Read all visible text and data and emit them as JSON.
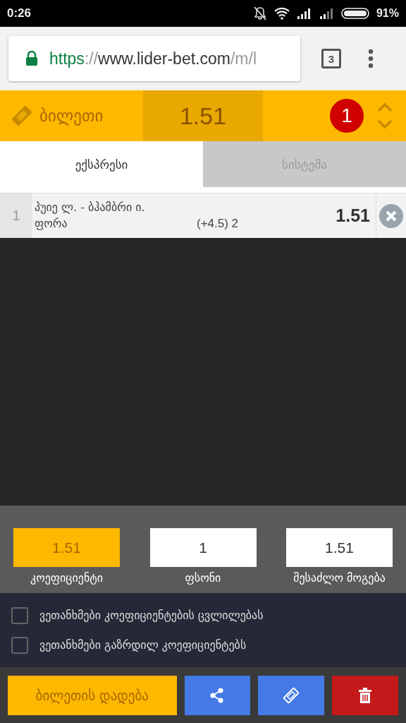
{
  "status_bar": {
    "time": "0:26",
    "battery": "91%"
  },
  "browser": {
    "url": [
      {
        "text": "https",
        "kind": "scheme"
      },
      {
        "text": "://",
        "kind": "faint"
      },
      {
        "text": "www.lider-bet.com",
        "kind": "host"
      },
      {
        "text": "/m/l",
        "kind": "faint"
      }
    ],
    "tab_count": "3"
  },
  "ticket_header": {
    "title": "ბილეთი",
    "odds": "1.51",
    "count": "1"
  },
  "tabs": [
    {
      "label": "ექსპრესი",
      "selected": true
    },
    {
      "label": "სისტემა",
      "selected": false
    }
  ],
  "bets": [
    {
      "number": "1",
      "event": "პუიე ლ. - ბჰამბრი ი.",
      "market": "ფორა",
      "pick": "(+4.5) 2",
      "odds": "1.51"
    }
  ],
  "summary": [
    {
      "value": "1.51",
      "label": "კოეფიციენტი",
      "highlighted": true
    },
    {
      "value": "1",
      "label": "ფსონი",
      "highlighted": false
    },
    {
      "value": "1.51",
      "label": "შესაძლო მოგება",
      "highlighted": false
    }
  ],
  "options": [
    {
      "label": "ვეთანხმები კოეფიციენტების ცვლილებას",
      "checked": false
    },
    {
      "label": "ვეთანხმები გაზრდილ კოეფიციენტებს",
      "checked": false
    }
  ],
  "place_button": "ბილეთის დადება"
}
